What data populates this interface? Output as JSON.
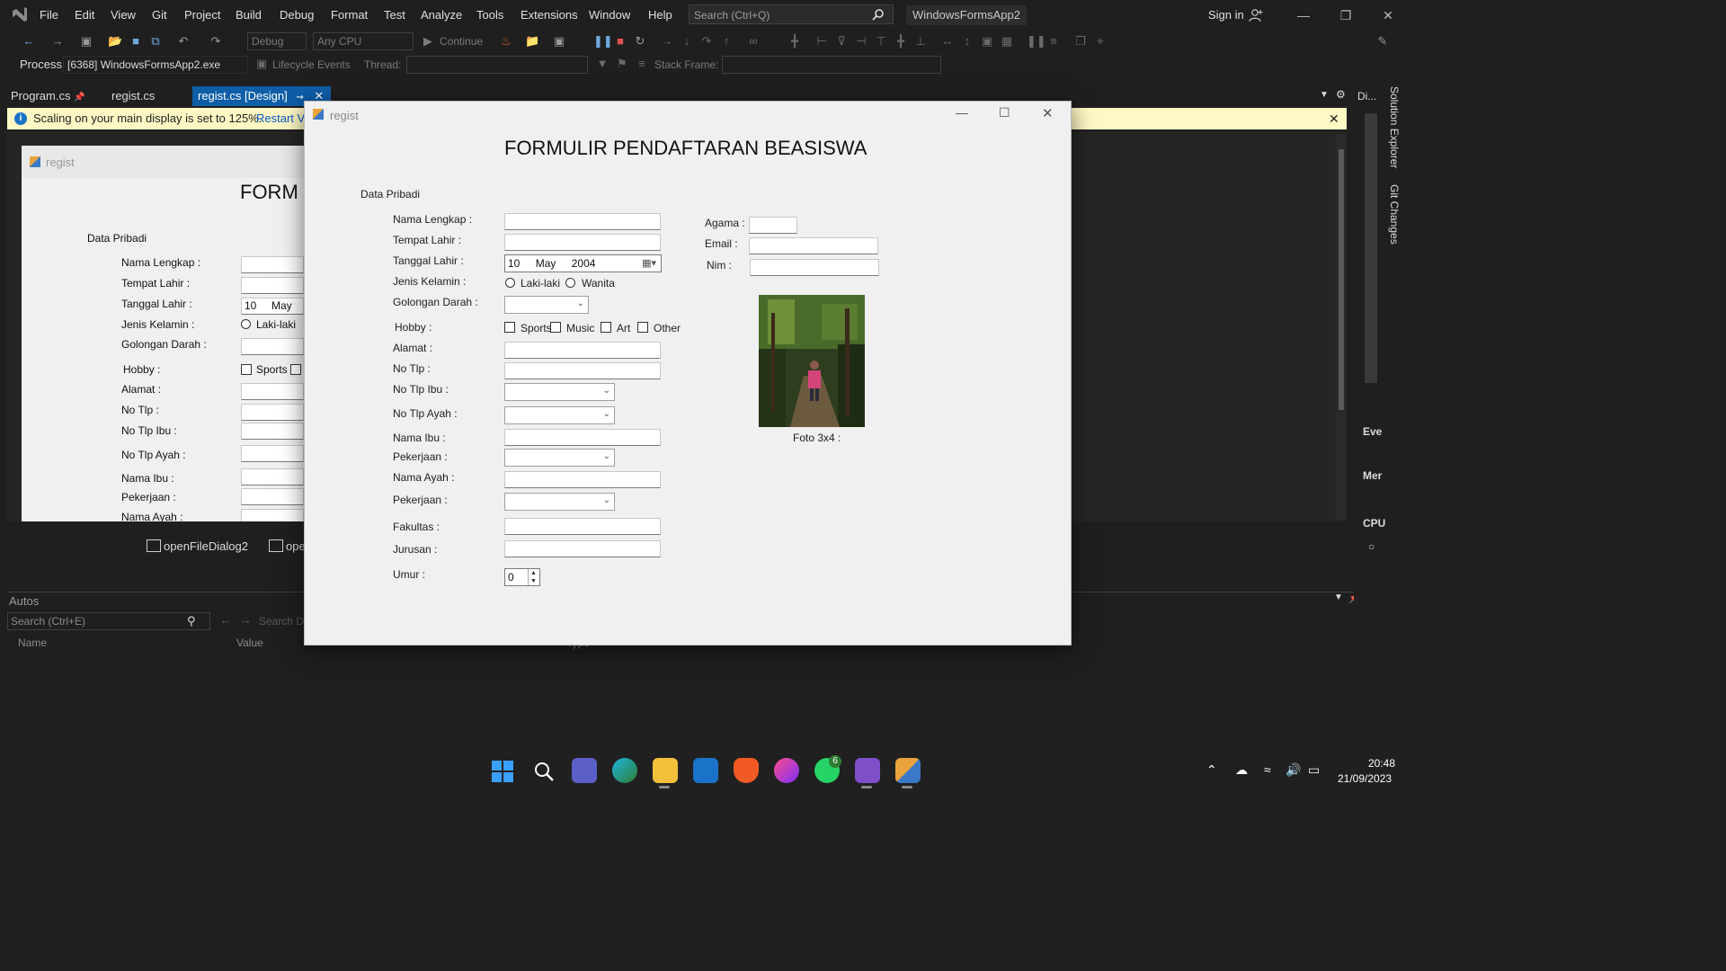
{
  "menu": {
    "items": [
      "File",
      "Edit",
      "View",
      "Git",
      "Project",
      "Build",
      "Debug",
      "Format",
      "Test",
      "Analyze",
      "Tools",
      "Extensions",
      "Window",
      "Help"
    ],
    "search_placeholder": "Search (Ctrl+Q)",
    "solution_name": "WindowsFormsApp2",
    "sign_in": "Sign in"
  },
  "toolbar": {
    "config": "Debug",
    "platform": "Any CPU",
    "continue_label": "Continue"
  },
  "debug_location": {
    "process_label": "Process:",
    "process_value": "[6368] WindowsFormsApp2.exe",
    "lifecycle_label": "Lifecycle Events",
    "thread_label": "Thread:",
    "stack_frame_label": "Stack Frame:"
  },
  "tabs": [
    {
      "label": "Program.cs",
      "active": false
    },
    {
      "label": "regist.cs",
      "active": false
    },
    {
      "label": "regist.cs [Design]",
      "active": true
    }
  ],
  "infobar": {
    "message": "Scaling on your main display is set to 125%.",
    "link": "Restart Vi"
  },
  "bg_designer": {
    "window_title": "regist",
    "title_partial": "FORM",
    "section": "Data Pribadi",
    "labels": [
      "Nama Lengkap :",
      "Tempat Lahir :",
      "Tanggal Lahir :",
      "Jenis Kelamin :",
      "Golongan Darah :",
      "Hobby :",
      "Alamat :",
      "No Tlp :",
      "No Tlp Ibu :",
      "No Tlp Ayah :",
      "Nama Ibu :",
      "Pekerjaan :",
      "Nama Ayah :"
    ],
    "date_day": "10",
    "date_month": "May",
    "radio_male": "Laki-laki",
    "hobby_sports": "Sports"
  },
  "tray": {
    "items": [
      "openFileDialog2",
      "ope"
    ]
  },
  "autos": {
    "title": "Autos",
    "search_placeholder": "Search (Ctrl+E)",
    "search_depth_placeholder": "Search D",
    "col_name": "Name",
    "col_value": "Value",
    "col_type": "Type"
  },
  "right_panel": {
    "tabs": [
      "Solution Explorer",
      "Git Changes"
    ],
    "diag_title": "Di...",
    "items": [
      "Eve",
      "Mer",
      "CPU"
    ]
  },
  "form": {
    "window_title": "regist",
    "heading": "FORMULIR PENDAFTARAN BEASISWA",
    "section": "Data Pribadi",
    "labels": {
      "nama_lengkap": "Nama Lengkap :",
      "tempat_lahir": "Tempat Lahir :",
      "tanggal_lahir": "Tanggal Lahir :",
      "jenis_kelamin": "Jenis Kelamin :",
      "golongan_darah": "Golongan Darah :",
      "hobby": "Hobby :",
      "alamat": "Alamat :",
      "no_tlp": "No Tlp :",
      "no_tlp_ibu": "No Tlp Ibu :",
      "no_tlp_ayah": "No Tlp Ayah :",
      "nama_ibu": "Nama Ibu :",
      "pekerjaan_ibu": "Pekerjaan :",
      "nama_ayah": "Nama Ayah :",
      "pekerjaan_ayah": "Pekerjaan :",
      "fakultas": "Fakultas :",
      "jurusan": "Jurusan :",
      "umur": "Umur :",
      "agama": "Agama :",
      "email": "Email :",
      "nim": "Nim :",
      "foto": "Foto 3x4 :"
    },
    "date": {
      "day": "10",
      "month": "May",
      "year": "2004"
    },
    "gender_options": [
      "Laki-laki",
      "Wanita"
    ],
    "hobby_options": [
      "Sports",
      "Music",
      "Art",
      "Other"
    ],
    "umur_value": "0"
  },
  "taskbar": {
    "whatsapp_badge": "6",
    "time": "20:48",
    "date": "21/09/2023"
  },
  "colors": {
    "vs_bg": "#1f1f1f",
    "accent": "#0e5ea8",
    "infobar": "#fff8c5",
    "form_bg": "#f0f0f0"
  }
}
